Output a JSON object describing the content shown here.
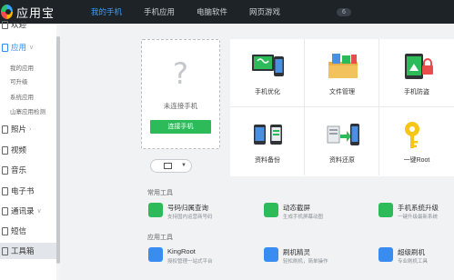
{
  "app": {
    "title": "应用宝"
  },
  "tabs": [
    {
      "label": "我的手机",
      "active": true
    },
    {
      "label": "手机应用"
    },
    {
      "label": "电脑软件"
    },
    {
      "label": "网页游戏"
    }
  ],
  "top_badge": "6",
  "sidebar": {
    "items": [
      {
        "label": "欢迎",
        "icon": "home-icon"
      },
      {
        "label": "应用",
        "icon": "app-icon",
        "chevron": "∨"
      },
      {
        "label": "我的应用"
      },
      {
        "label": "可升级"
      },
      {
        "label": "系统应用"
      },
      {
        "label": "山寨应用检测"
      },
      {
        "label": "照片",
        "icon": "photo-icon",
        "chevron": "›"
      },
      {
        "label": "视频",
        "icon": "video-icon"
      },
      {
        "label": "音乐",
        "icon": "music-icon"
      },
      {
        "label": "电子书",
        "icon": "book-icon"
      },
      {
        "label": "通讯录",
        "icon": "contacts-icon",
        "chevron": "∨"
      },
      {
        "label": "短信",
        "icon": "sms-icon"
      },
      {
        "label": "工具箱",
        "icon": "toolbox-icon"
      }
    ]
  },
  "device": {
    "question_mark": "?",
    "status": "未连接手机",
    "connect_label": "连接手机"
  },
  "grid": [
    {
      "label": "手机优化",
      "icon": "phone-optimize-icon"
    },
    {
      "label": "文件管理",
      "icon": "file-manager-icon"
    },
    {
      "label": "手机防盗",
      "icon": "anti-theft-icon"
    },
    {
      "label": "资料备份",
      "icon": "backup-icon"
    },
    {
      "label": "资料还原",
      "icon": "restore-icon"
    },
    {
      "label": "一键Root",
      "icon": "root-key-icon"
    }
  ],
  "common_tools": {
    "title": "常用工具",
    "items": [
      {
        "name": "号码归属查询",
        "desc": "支持国内运营商号码",
        "icon": "number-query-icon",
        "color": "#2dbb5a"
      },
      {
        "name": "动态截屏",
        "desc": "生成手机屏幕动图",
        "icon": "screenshot-icon",
        "color": "#2dbb5a"
      },
      {
        "name": "手机系统升级",
        "desc": "一键升级最新系统",
        "icon": "system-upgrade-icon",
        "color": "#2dbb5a"
      }
    ]
  },
  "app_tools": {
    "title": "应用工具",
    "items": [
      {
        "name": "KingRoot",
        "desc": "授权管理一站式平台",
        "icon": "kingroot-icon",
        "color": "#3a8df0"
      },
      {
        "name": "刷机精灵",
        "desc": "轻松刷机，简单操作",
        "icon": "flash-wizard-icon",
        "color": "#3a8df0"
      },
      {
        "name": "超级刷机",
        "desc": "专业刷机工具",
        "icon": "super-flash-icon",
        "color": "#3a8df0"
      }
    ]
  }
}
